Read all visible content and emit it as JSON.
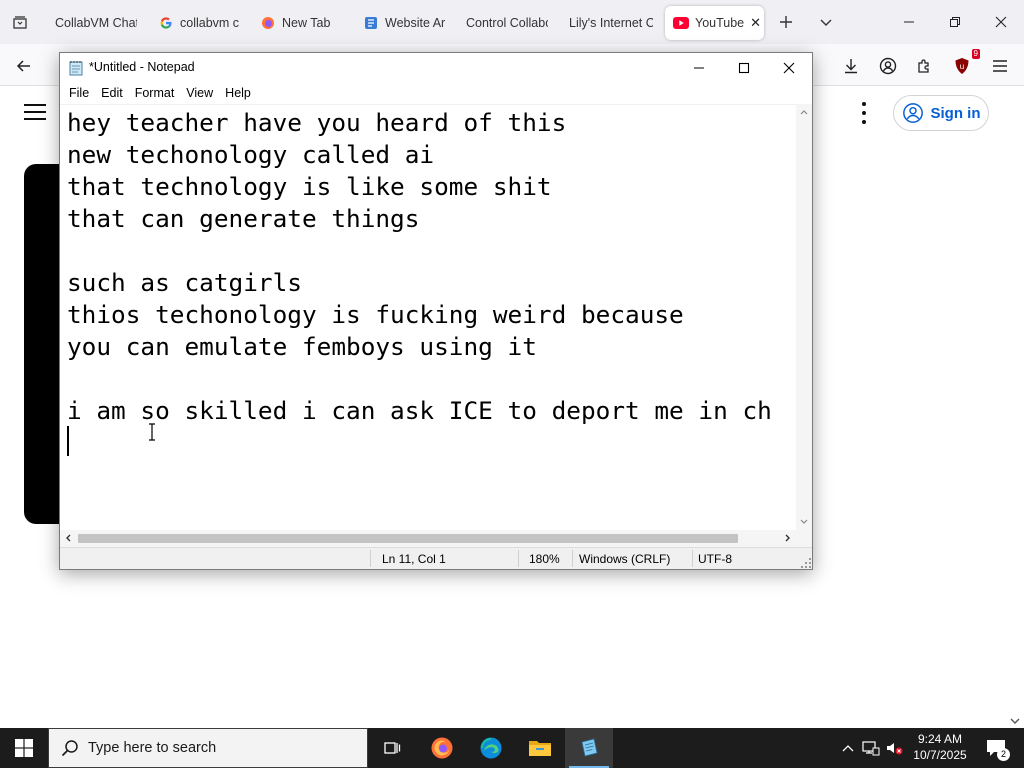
{
  "browser": {
    "tabs": [
      {
        "label": "CollabVM Chat",
        "icon": "collabvm-icon"
      },
      {
        "label": "collabvm c",
        "icon": "google-icon"
      },
      {
        "label": "New Tab",
        "icon": "firefox-icon"
      },
      {
        "label": "Website Ar",
        "icon": "website-icon"
      },
      {
        "label": "Control Collabc",
        "icon": "none"
      },
      {
        "label": "Lily's Internet C",
        "icon": "none"
      },
      {
        "label": "YouTube",
        "icon": "youtube-icon",
        "active": true
      }
    ],
    "extension_badge": "9"
  },
  "youtube": {
    "sign_in_label": "Sign in",
    "accent_color": "#065fd4"
  },
  "notepad": {
    "title": "*Untitled - Notepad",
    "menu": [
      "File",
      "Edit",
      "Format",
      "View",
      "Help"
    ],
    "lines": [
      "hey teacher have you heard of this",
      "new techonology called ai",
      "that technology is like some shit",
      "that can generate things",
      "",
      "such as catgirls",
      "thios techonology is fucking weird because",
      "you can emulate femboys using it",
      "",
      "i am so skilled i can ask ICE to deport me in ch",
      ""
    ],
    "status": {
      "position": "Ln 11, Col 1",
      "zoom": "180%",
      "line_ending": "Windows (CRLF)",
      "encoding": "UTF-8"
    }
  },
  "taskbar": {
    "search_placeholder": "Type here to search",
    "time": "9:24 AM",
    "date": "10/7/2025",
    "notification_count": "2",
    "apps": [
      "task-view-icon",
      "firefox-icon",
      "edge-icon",
      "file-explorer-icon",
      "notepad-icon"
    ]
  }
}
